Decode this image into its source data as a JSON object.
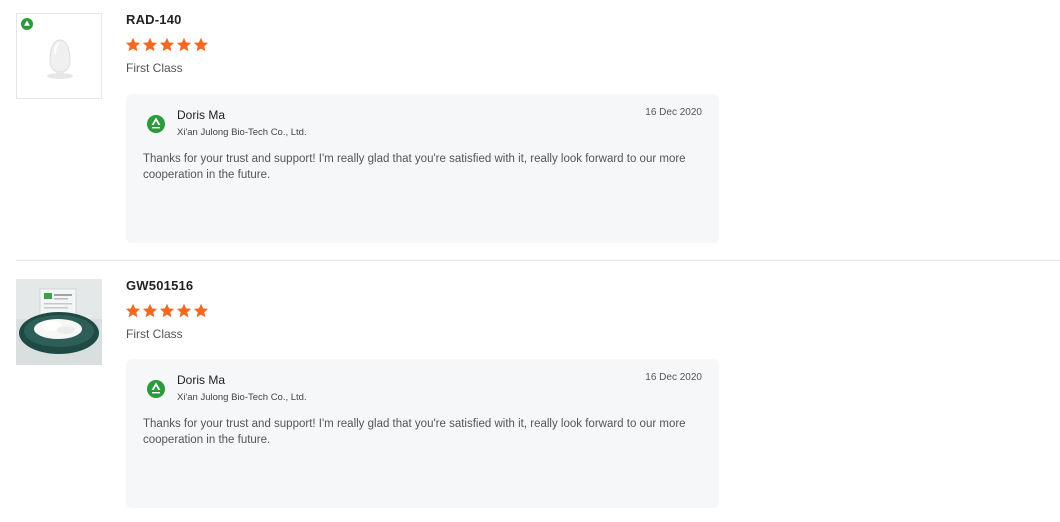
{
  "reviews": [
    {
      "product_name": "RAD-140",
      "stars": 5,
      "rating_label": "First Class",
      "thumbnail_icon": "white-pill-bottle-image",
      "reply": {
        "author": "Doris Ma",
        "company": "Xi'an Julong Bio-Tech Co., Ltd.",
        "date": "16 Dec 2020",
        "text": "Thanks for your trust and support! I'm really glad that you're satisfied with it, really look forward to our more cooperation in the future."
      }
    },
    {
      "product_name": "GW501516",
      "stars": 5,
      "rating_label": "First Class",
      "thumbnail_icon": "powder-in-dish-image",
      "reply": {
        "author": "Doris Ma",
        "company": "Xi'an Julong Bio-Tech Co., Ltd.",
        "date": "16 Dec 2020",
        "text": "Thanks for your trust and support! I'm really glad that you're satisfied with it, really look forward to our more cooperation in the future."
      }
    }
  ],
  "colors": {
    "star": "#f26a21",
    "brand_green": "#2a9a3a",
    "reply_background": "#f6f7f8",
    "divider": "#e3e3e3"
  }
}
